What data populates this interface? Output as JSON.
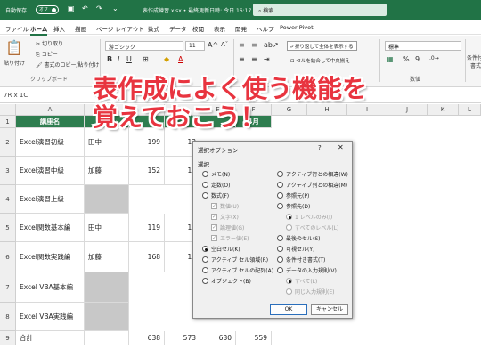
{
  "titlebar": {
    "autosave": "自動保存",
    "toggle": "オフ",
    "title": "表作成練習.xlsx • 最終更新日時: 今日 16:17 ⌄",
    "search": "検索"
  },
  "ribbon_tabs": [
    "ファイル",
    "ホーム",
    "挿入",
    "描画",
    "ページ レイアウト",
    "数式",
    "データ",
    "校閲",
    "表示",
    "開発",
    "ヘルプ",
    "Power Pivot"
  ],
  "ribbon": {
    "paste": "貼り付け",
    "cut": "切り取り",
    "copy": "コピー",
    "format_painter": "書式のコピー/貼り付け",
    "clipboard": "クリップボード",
    "font": "游ゴシック",
    "font_size": "11",
    "wrap": "折り返して全体を表示する",
    "merge": "セルを結合して中央揃え",
    "number_format": "標準",
    "numeric": "数値",
    "conditional": "条件付き",
    "conditional2": "書式"
  },
  "formula": {
    "name_box": "7R x 1C"
  },
  "overlay": {
    "line1": "表作成によく使う機能を",
    "line2": "覚えておこう！"
  },
  "columns": [
    "A",
    "B",
    "C",
    "D",
    "E",
    "F",
    "G",
    "H",
    "I",
    "J",
    "K",
    "L"
  ],
  "header_row": {
    "b": "講座名",
    "f": "4月"
  },
  "rows": [
    {
      "n": "2",
      "name": "Excel演習初級",
      "c": "田中",
      "d": "199",
      "e": "13"
    },
    {
      "n": "3",
      "name": "Excel演習中級",
      "c": "加藤",
      "d": "152",
      "e": "16"
    },
    {
      "n": "4",
      "name": "Excel演習上級",
      "c": "",
      "d": "",
      "e": ""
    },
    {
      "n": "5",
      "name": "Excel関数基本編",
      "c": "田中",
      "d": "119",
      "e": "15"
    },
    {
      "n": "6",
      "name": "Excel関数実践編",
      "c": "加藤",
      "d": "168",
      "e": "17"
    },
    {
      "n": "7",
      "name": "Excel VBA基本編",
      "c": "",
      "d": "",
      "e": ""
    },
    {
      "n": "8",
      "name": "Excel VBA実践編",
      "c": "",
      "d": "",
      "e": ""
    }
  ],
  "total_row": {
    "n": "9",
    "label": "合計",
    "d": "638",
    "e": "573",
    "f": "630",
    "g": "559"
  },
  "row1": "1",
  "dialog": {
    "title": "選択オプション",
    "help": "?",
    "close": "✕",
    "section": "選択",
    "left": [
      "メモ(N)",
      "定数(O)",
      "数式(F)",
      "数値(U)",
      "文字(X)",
      "論理値(G)",
      "エラー値(E)",
      "空白セル(K)",
      "アクティブ セル領域(R)",
      "アクティブ セルの配列(A)",
      "オブジェクト(B)"
    ],
    "right": [
      "アクティブ行との相違(W)",
      "アクティブ列との相違(M)",
      "参照元(P)",
      "参照先(D)",
      "1 レベルのみ(I)",
      "すべてのレベル(L)",
      "最後のセル(S)",
      "可視セル(Y)",
      "条件付き書式(T)",
      "データの入力規則(V)",
      "すべて(L)",
      "同じ入力規則(E)"
    ],
    "ok": "OK",
    "cancel": "キャンセル"
  }
}
